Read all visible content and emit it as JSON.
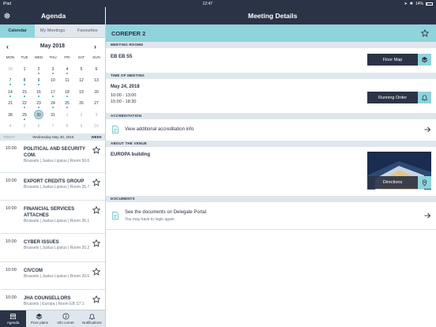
{
  "status": {
    "device": "iPad",
    "time": "12:47",
    "battery": "14%",
    "battery_level": 0.14
  },
  "left_header": {
    "title": "Agenda",
    "settings_icon": "gear-icon"
  },
  "right_header": {
    "title": "Meeting Details"
  },
  "tabs": [
    {
      "label": "Calendar",
      "active": true
    },
    {
      "label": "My Meetings",
      "active": false
    },
    {
      "label": "Favourites",
      "active": false
    }
  ],
  "calendar": {
    "month_label": "May 2018",
    "weekdays": [
      "MON",
      "TUE",
      "WED",
      "THU",
      "FRI",
      "SAT",
      "SUN"
    ],
    "weeks": [
      [
        {
          "d": "30",
          "m": false,
          "dot": false
        },
        {
          "d": "1",
          "m": true,
          "dot": false
        },
        {
          "d": "2",
          "m": true,
          "dot": true
        },
        {
          "d": "3",
          "m": true,
          "dot": true
        },
        {
          "d": "4",
          "m": true,
          "dot": true
        },
        {
          "d": "5",
          "m": true,
          "dot": false
        },
        {
          "d": "6",
          "m": true,
          "dot": false
        }
      ],
      [
        {
          "d": "7",
          "m": true,
          "dot": true
        },
        {
          "d": "8",
          "m": true,
          "dot": true
        },
        {
          "d": "9",
          "m": true,
          "dot": true
        },
        {
          "d": "10",
          "m": true,
          "dot": false
        },
        {
          "d": "11",
          "m": true,
          "dot": false
        },
        {
          "d": "12",
          "m": true,
          "dot": false
        },
        {
          "d": "13",
          "m": true,
          "dot": false
        }
      ],
      [
        {
          "d": "14",
          "m": true,
          "dot": true
        },
        {
          "d": "15",
          "m": true,
          "dot": true
        },
        {
          "d": "16",
          "m": true,
          "dot": true
        },
        {
          "d": "17",
          "m": true,
          "dot": true
        },
        {
          "d": "18",
          "m": true,
          "dot": true
        },
        {
          "d": "19",
          "m": true,
          "dot": false
        },
        {
          "d": "20",
          "m": true,
          "dot": false
        }
      ],
      [
        {
          "d": "21",
          "m": true,
          "dot": false
        },
        {
          "d": "22",
          "m": true,
          "dot": true
        },
        {
          "d": "23",
          "m": true,
          "dot": true
        },
        {
          "d": "24",
          "m": true,
          "dot": true
        },
        {
          "d": "25",
          "m": true,
          "dot": true
        },
        {
          "d": "26",
          "m": true,
          "dot": false
        },
        {
          "d": "27",
          "m": true,
          "dot": false
        }
      ],
      [
        {
          "d": "28",
          "m": true,
          "dot": false
        },
        {
          "d": "29",
          "m": true,
          "dot": true
        },
        {
          "d": "30",
          "m": true,
          "dot": false,
          "selected": true
        },
        {
          "d": "31",
          "m": true,
          "dot": false
        },
        {
          "d": "1",
          "m": false,
          "dot": false
        },
        {
          "d": "2",
          "m": false,
          "dot": false
        },
        {
          "d": "3",
          "m": false,
          "dot": false
        }
      ],
      [
        {
          "d": "4",
          "m": false,
          "dot": false
        },
        {
          "d": "5",
          "m": false,
          "dot": false
        },
        {
          "d": "6",
          "m": false,
          "dot": false
        },
        {
          "d": "7",
          "m": false,
          "dot": false
        },
        {
          "d": "8",
          "m": false,
          "dot": false
        },
        {
          "d": "9",
          "m": false,
          "dot": false
        },
        {
          "d": "10",
          "m": false,
          "dot": false
        }
      ]
    ]
  },
  "today_bar": {
    "left": "TODAY",
    "date": "Wednesday May 30, 2018",
    "right": "WEEK"
  },
  "meetings": [
    {
      "time": "10:00",
      "title": "POLITICAL AND SECURITY COM.",
      "location": "Brussels | Justus Lipsius | Room 50.6"
    },
    {
      "time": "10:00",
      "title": "EXPORT CREDITS GROUP",
      "location": "Brussels | Justus Lipsius | Room 35.7"
    },
    {
      "time": "10:00",
      "title": "FINANCIAL SERVICES ATTACHES",
      "location": "Brussels | Justus Lipsius | Room 35.1"
    },
    {
      "time": "10:00",
      "title": "CYBER ISSUES",
      "location": "Brussels | Justus Lipsius | Room 20.2"
    },
    {
      "time": "10:00",
      "title": "CIVCOM",
      "location": "Brussels | Justus Lipsius | Room 20.6"
    },
    {
      "time": "10:00",
      "title": "JHA COUNSELLORS",
      "location": "Brussels | Europa | Room EB S7.1"
    }
  ],
  "tabbar": [
    {
      "label": "Agenda",
      "icon": "calendar-icon",
      "active": true
    },
    {
      "label": "Floor plans",
      "icon": "layers-icon",
      "active": false
    },
    {
      "label": "Info corner",
      "icon": "info-icon",
      "active": false
    },
    {
      "label": "Notifications",
      "icon": "bell-icon",
      "active": false
    }
  ],
  "details": {
    "meeting_title": "COREPER 2",
    "sections": {
      "rooms": "MEETING ROOMS",
      "time": "TIME OF MEETING",
      "accreditation": "ACCREDITATION",
      "venue": "ABOUT THE VENUE",
      "documents": "DOCUMENTS"
    },
    "room": "EB EB S5",
    "floor_map_label": "Floor Map",
    "date": "May 24, 2018",
    "time_slots": [
      "10:00 - 13:00",
      "15:00 - 18:30"
    ],
    "running_order_label": "Running Order",
    "accreditation_link": "View additional accreditation info",
    "venue_name": "EUROPA building",
    "directions_label": "Directions",
    "documents_link": "See the documents on Delegate Portal",
    "documents_note": "You may have to login again"
  },
  "colors": {
    "navy": "#2b3347",
    "teal": "#8fd3db",
    "accent_dot": "#34a9b2"
  }
}
